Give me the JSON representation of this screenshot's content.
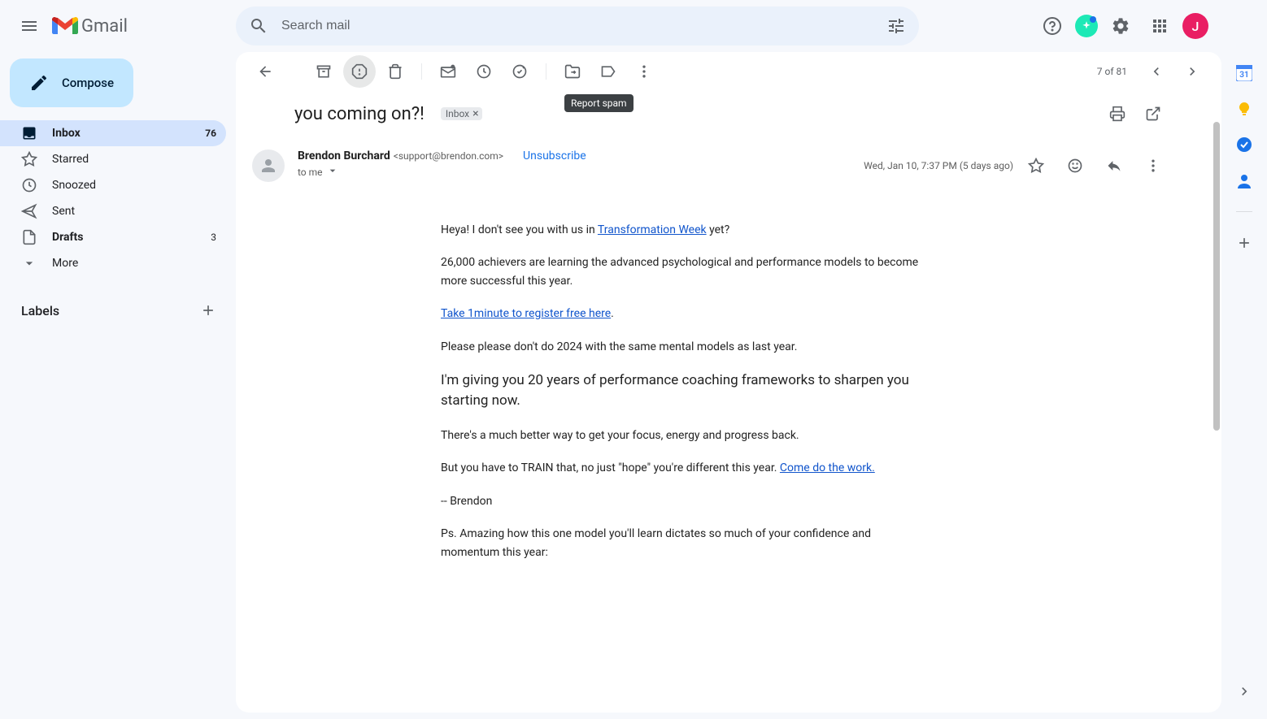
{
  "header": {
    "logo_text": "Gmail"
  },
  "search": {
    "placeholder": "Search mail"
  },
  "compose": {
    "label": "Compose"
  },
  "nav": {
    "items": [
      {
        "label": "Inbox",
        "count": "76"
      },
      {
        "label": "Starred",
        "count": ""
      },
      {
        "label": "Snoozed",
        "count": ""
      },
      {
        "label": "Sent",
        "count": ""
      },
      {
        "label": "Drafts",
        "count": "3"
      },
      {
        "label": "More",
        "count": ""
      }
    ]
  },
  "labels": {
    "header": "Labels"
  },
  "toolbar": {
    "tooltip": "Report spam",
    "page_info": "7 of 81"
  },
  "mail": {
    "subject": "you coming on?!",
    "chip": "Inbox",
    "sender_name": "Brendon Burchard",
    "sender_email": "<support@brendon.com>",
    "unsubscribe": "Unsubscribe",
    "to_line": "to me",
    "date": "Wed, Jan 10, 7:37 PM (5 days ago)"
  },
  "body": {
    "p1a": "Heya! I don't see you with us in ",
    "p1link": "Transformation Week",
    "p1b": " yet?",
    "p2": "26,000 achievers are learning the advanced psychological and performance models to become more successful this year.",
    "p3link": "Take 1minute to register free here",
    "p3b": ".",
    "p4": "Please please don't do 2024 with the same mental models as last year.",
    "p5": "I'm giving you 20 years of performance coaching frameworks to sharpen you starting now.",
    "p6": "There's a much better way to get your focus, energy and progress back.",
    "p7a": "But you have to TRAIN that, no just \"hope\" you're different this year. ",
    "p7link": "Come do the work.",
    "p8": "-- Brendon",
    "p9": "Ps. Amazing how this one model you'll learn dictates so much of your confidence and momentum this year:"
  },
  "avatar": {
    "initial": "J"
  }
}
